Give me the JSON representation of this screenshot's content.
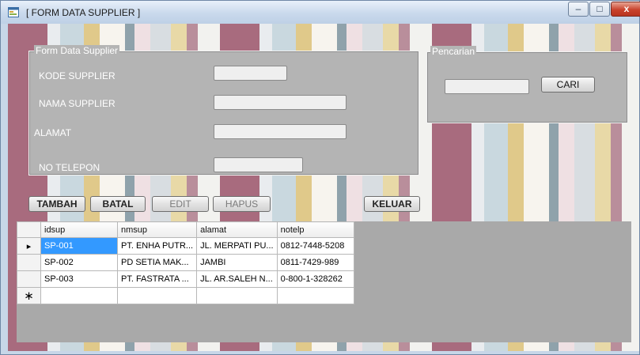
{
  "window": {
    "title": "[ FORM DATA SUPPLIER ]",
    "minimize": "–",
    "maximize": "□",
    "close": "x"
  },
  "form": {
    "legend": "Form Data Supplier",
    "fields": [
      {
        "label": "KODE SUPPLIER",
        "value": ""
      },
      {
        "label": "NAMA SUPPLIER",
        "value": ""
      },
      {
        "label": "ALAMAT",
        "value": ""
      },
      {
        "label": "NO TELEPON",
        "value": ""
      }
    ]
  },
  "search": {
    "legend": "Pencarian",
    "value": "",
    "button": "CARI"
  },
  "buttons": {
    "tambah": "TAMBAH",
    "batal": "BATAL",
    "edit": "EDIT",
    "hapus": "HAPUS",
    "keluar": "KELUAR"
  },
  "grid": {
    "columns": [
      "idsup",
      "nmsup",
      "alamat",
      "notelp"
    ],
    "rows": [
      [
        "SP-001",
        "PT. ENHA PUTR...",
        "JL. MERPATI PU...",
        "0812-7448-5208"
      ],
      [
        "SP-002",
        "PD SETIA MAK...",
        "JAMBI",
        "0811-7429-989"
      ],
      [
        "SP-003",
        "PT. FASTRATA ...",
        "JL. AR.SALEH N...",
        "0-800-1-328262"
      ]
    ],
    "current_row_marker": "▸",
    "new_row_marker": "∗",
    "selected_row": 0
  },
  "colors": {
    "groupbox": "#b4b4b4",
    "selection": "#3399ff",
    "grid_background": "#a9a9a9"
  }
}
